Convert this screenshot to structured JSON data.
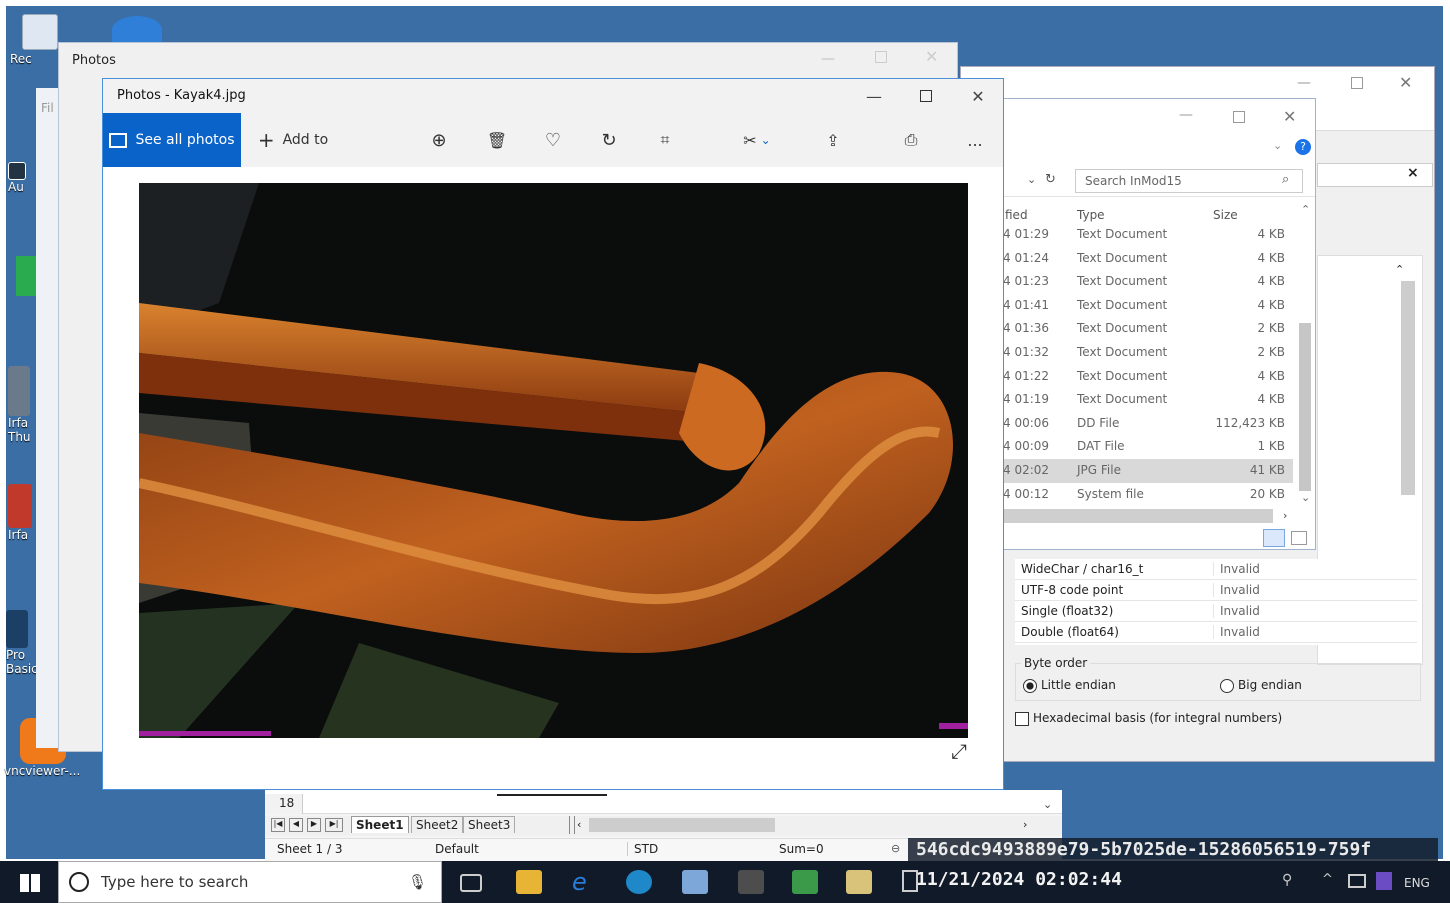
{
  "desktop": {
    "icons": [
      {
        "label": "Rec",
        "icon": "recycle-bin-icon"
      },
      {
        "label": "Au",
        "icon": "app-icon"
      },
      {
        "label": "Irfa Thu",
        "icon": "irfanview-thumbnails-icon"
      },
      {
        "label": "Irfa",
        "icon": "irfanview-icon"
      },
      {
        "label": "Pro Basic",
        "icon": "app-icon"
      },
      {
        "label": "vncviewer-...",
        "icon": "vncviewer-icon"
      }
    ]
  },
  "photos_back": {
    "title": "Photos",
    "file_label": "Fil"
  },
  "photos_window": {
    "title": "Photos - Kayak4.jpg",
    "see_all_label": "See all photos",
    "add_to_label": "Add to",
    "more_label": "...",
    "tools": [
      "zoom-icon",
      "delete-icon",
      "heart-icon",
      "rotate-icon",
      "crop-icon",
      "edit-icon",
      "share-icon",
      "print-icon"
    ]
  },
  "explorer": {
    "search_placeholder": "Search InMod15",
    "columns": {
      "modified": "fied",
      "type": "Type",
      "size": "Size"
    },
    "rows": [
      {
        "modified": "4 01:29",
        "type": "Text Document",
        "size": "4 KB"
      },
      {
        "modified": "4 01:24",
        "type": "Text Document",
        "size": "4 KB"
      },
      {
        "modified": "4 01:23",
        "type": "Text Document",
        "size": "4 KB"
      },
      {
        "modified": "4 01:41",
        "type": "Text Document",
        "size": "4 KB"
      },
      {
        "modified": "4 01:36",
        "type": "Text Document",
        "size": "2 KB"
      },
      {
        "modified": "4 01:32",
        "type": "Text Document",
        "size": "2 KB"
      },
      {
        "modified": "4 01:22",
        "type": "Text Document",
        "size": "4 KB"
      },
      {
        "modified": "4 01:19",
        "type": "Text Document",
        "size": "4 KB"
      },
      {
        "modified": "4 00:06",
        "type": "DD File",
        "size": "112,423 KB"
      },
      {
        "modified": "4 00:09",
        "type": "DAT File",
        "size": "1 KB"
      },
      {
        "modified": "4 02:02",
        "type": "JPG File",
        "size": "41 KB"
      },
      {
        "modified": "4 00:12",
        "type": "System file",
        "size": "20 KB"
      }
    ],
    "selected_index": 10
  },
  "hex_panel": {
    "close_label": "×",
    "rows": [
      {
        "name": "WideChar / char16_t",
        "value": "Invalid"
      },
      {
        "name": "UTF-8 code point",
        "value": "Invalid"
      },
      {
        "name": "Single (float32)",
        "value": "Invalid"
      },
      {
        "name": "Double (float64)",
        "value": "Invalid"
      }
    ],
    "byte_order_label": "Byte order",
    "little_endian_label": "Little endian",
    "big_endian_label": "Big endian",
    "hex_basis_label": "Hexadecimal basis (for integral numbers)"
  },
  "calc": {
    "row_number": "18",
    "tabs": [
      "Sheet1",
      "Sheet2",
      "Sheet3"
    ],
    "active_tab": "Sheet1",
    "status_sheet": "Sheet 1 / 3",
    "status_style": "Default",
    "status_mode": "STD",
    "status_sum": "Sum=0"
  },
  "overlay": {
    "id_text": "546cdc9493889e79-5b7025de-15286056519-759f",
    "datetime": "11/21/2024 02:02:44"
  },
  "taskbar": {
    "search_placeholder": "Type here to search",
    "lang": "ENG"
  }
}
